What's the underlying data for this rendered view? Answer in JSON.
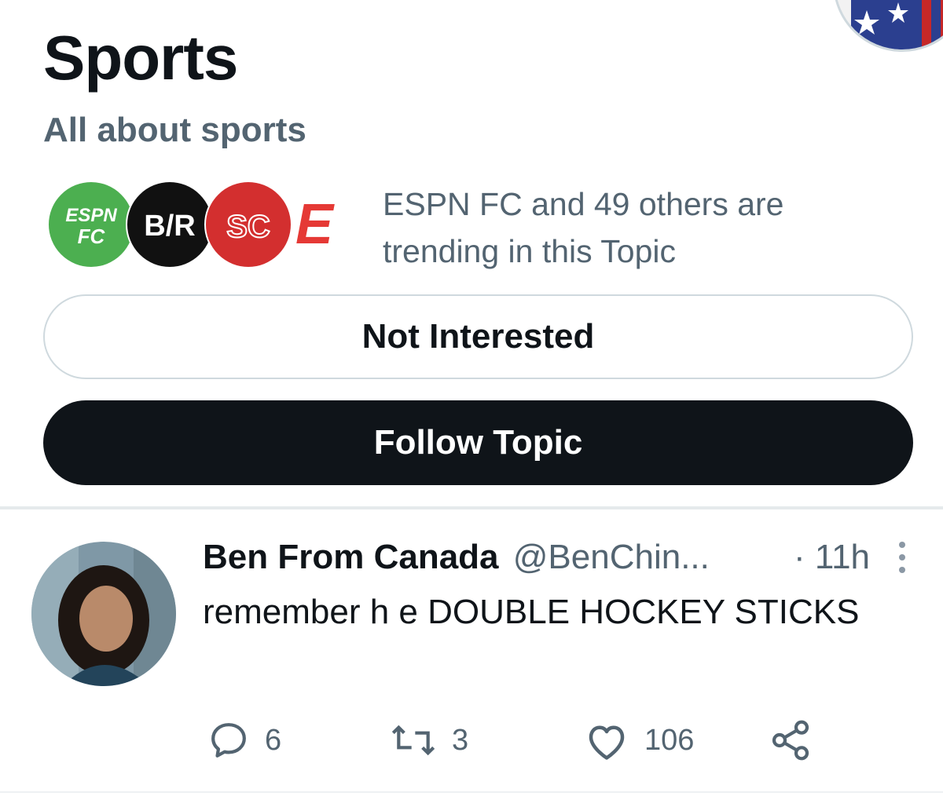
{
  "topic": {
    "title": "Sports",
    "subtitle": "All about sports",
    "trending_text": "ESPN FC and 49 others are trending in this Topic",
    "logos": [
      {
        "name": "ESPN FC",
        "color": "#4caf50",
        "text_top": "ESPN",
        "text_bottom": "FC"
      },
      {
        "name": "B/R",
        "color": "#111111",
        "text": "B/R"
      },
      {
        "name": "SC",
        "color": "#d32f2f",
        "text": "SC"
      },
      {
        "name": "ESPN",
        "color": "#e53935",
        "text": "E"
      }
    ]
  },
  "buttons": {
    "not_interested": "Not Interested",
    "follow_topic": "Follow Topic"
  },
  "tweet": {
    "author": "Ben From Canada",
    "handle": "@BenChin...",
    "time": "· 11h",
    "text": "remember h e DOUBLE HOCKEY STICKS",
    "replies": "6",
    "retweets": "3",
    "likes": "106"
  },
  "colors": {
    "primary_text": "#0f1419",
    "secondary_text": "#536471",
    "border": "#cfd9de",
    "button_dark": "#0f1419"
  },
  "icons": [
    "reply-icon",
    "retweet-icon",
    "like-icon",
    "share-icon",
    "more-icon"
  ]
}
